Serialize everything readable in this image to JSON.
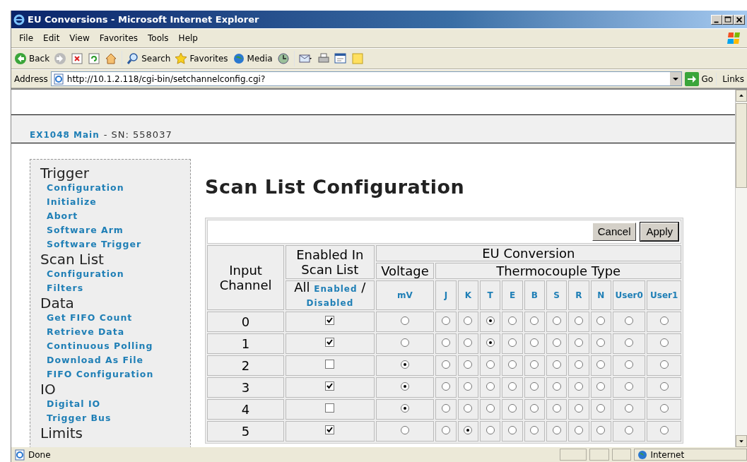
{
  "window": {
    "title": "EU Conversions - Microsoft Internet Explorer"
  },
  "menu": [
    "File",
    "Edit",
    "View",
    "Favorites",
    "Tools",
    "Help"
  ],
  "toolbar": [
    {
      "kind": "back",
      "label": "Back"
    },
    {
      "kind": "forward"
    },
    {
      "kind": "stop"
    },
    {
      "kind": "refresh"
    },
    {
      "kind": "home"
    },
    {
      "kind": "search",
      "label": "Search"
    },
    {
      "kind": "favorites",
      "label": "Favorites"
    },
    {
      "kind": "media",
      "label": "Media"
    },
    {
      "kind": "history"
    },
    {
      "kind": "mail"
    },
    {
      "kind": "print"
    },
    {
      "kind": "edit"
    },
    {
      "kind": "note"
    }
  ],
  "address": {
    "label": "Address",
    "url": "http://10.1.2.118/cgi-bin/setchannelconfig.cgi?",
    "go": "Go",
    "links": "Links"
  },
  "page": {
    "home_link": "EX1048 Main",
    "serial": "- SN: 558037",
    "nav": [
      {
        "title": "Trigger",
        "links": [
          "Configuration",
          "Initialize",
          "Abort",
          "Software Arm",
          "Software Trigger"
        ]
      },
      {
        "title": "Scan List",
        "links": [
          "Configuration",
          "Filters"
        ]
      },
      {
        "title": "Data",
        "links": [
          "Get FIFO Count",
          "Retrieve Data",
          "Continuous Polling",
          "Download As File",
          "FIFO Configuration"
        ]
      },
      {
        "title": "IO",
        "links": [
          "Digital IO",
          "Trigger Bus"
        ]
      },
      {
        "title": "Limits"
      }
    ],
    "heading": "Scan List Configuration",
    "buttons": [
      "Cancel",
      "Apply"
    ],
    "table": {
      "input_channel": "Input Channel",
      "enabled_in": "Enabled In Scan List",
      "eu_conversion": "EU Conversion",
      "voltage": "Voltage",
      "thermocouple": "Thermocouple Type",
      "all": "All",
      "enabled_link": "Enabled",
      "slash": "/",
      "disabled_link": "Disabled",
      "columns": [
        "mV",
        "J",
        "K",
        "T",
        "E",
        "B",
        "S",
        "R",
        "N",
        "User0",
        "User1"
      ],
      "rows": [
        {
          "channel": "0",
          "enabled": true,
          "options": [
            {
              "selected": false
            },
            {
              "selected": false
            },
            {
              "selected": false
            },
            {
              "selected": true
            },
            {
              "selected": false
            },
            {
              "selected": false
            },
            {
              "selected": false
            },
            {
              "selected": false
            },
            {
              "selected": false
            },
            {
              "selected": false
            },
            {
              "selected": false
            }
          ]
        },
        {
          "channel": "1",
          "enabled": true,
          "options": [
            {
              "selected": false
            },
            {
              "selected": false
            },
            {
              "selected": false
            },
            {
              "selected": true
            },
            {
              "selected": false
            },
            {
              "selected": false
            },
            {
              "selected": false
            },
            {
              "selected": false
            },
            {
              "selected": false
            },
            {
              "selected": false
            },
            {
              "selected": false
            }
          ]
        },
        {
          "channel": "2",
          "enabled": false,
          "options": [
            {
              "selected": true
            },
            {
              "selected": false
            },
            {
              "selected": false
            },
            {
              "selected": false
            },
            {
              "selected": false
            },
            {
              "selected": false
            },
            {
              "selected": false
            },
            {
              "selected": false
            },
            {
              "selected": false
            },
            {
              "selected": false
            },
            {
              "selected": false
            }
          ]
        },
        {
          "channel": "3",
          "enabled": true,
          "options": [
            {
              "selected": true
            },
            {
              "selected": false
            },
            {
              "selected": false
            },
            {
              "selected": false
            },
            {
              "selected": false
            },
            {
              "selected": false
            },
            {
              "selected": false
            },
            {
              "selected": false
            },
            {
              "selected": false
            },
            {
              "selected": false
            },
            {
              "selected": false
            }
          ]
        },
        {
          "channel": "4",
          "enabled": false,
          "options": [
            {
              "selected": true
            },
            {
              "selected": false
            },
            {
              "selected": false
            },
            {
              "selected": false
            },
            {
              "selected": false
            },
            {
              "selected": false
            },
            {
              "selected": false
            },
            {
              "selected": false
            },
            {
              "selected": false
            },
            {
              "selected": false
            },
            {
              "selected": false
            }
          ]
        },
        {
          "channel": "5",
          "enabled": true,
          "options": [
            {
              "selected": false
            },
            {
              "selected": false
            },
            {
              "selected": true
            },
            {
              "selected": false
            },
            {
              "selected": false
            },
            {
              "selected": false
            },
            {
              "selected": false
            },
            {
              "selected": false
            },
            {
              "selected": false
            },
            {
              "selected": false
            },
            {
              "selected": false
            }
          ]
        }
      ]
    }
  },
  "status": {
    "text": "Done",
    "zone": "Internet"
  }
}
